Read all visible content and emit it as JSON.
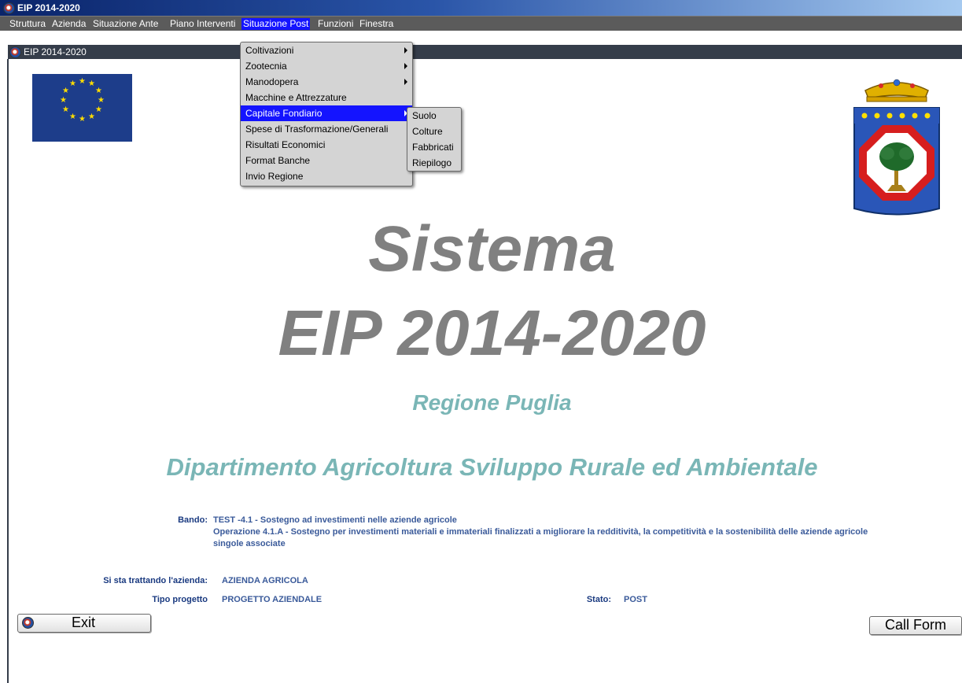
{
  "window": {
    "outer_title": "EIP 2014-2020",
    "inner_title": "EIP 2014-2020"
  },
  "menubar": [
    {
      "label": "Struttura"
    },
    {
      "label": "Azienda"
    },
    {
      "label": "Situazione Ante"
    },
    {
      "label": "Piano Interventi"
    },
    {
      "label": "Situazione Post"
    },
    {
      "label": "Funzioni"
    },
    {
      "label": "Finestra"
    }
  ],
  "dropdown_post": [
    {
      "label": "Coltivazioni"
    },
    {
      "label": "Zootecnia"
    },
    {
      "label": "Manodopera"
    },
    {
      "label": "Macchine e Attrezzature"
    },
    {
      "label": "Capitale Fondiario"
    },
    {
      "label": "Spese di Trasformazione/Generali"
    },
    {
      "label": "Risultati Economici"
    },
    {
      "label": "Format Banche"
    },
    {
      "label": "Invio Regione"
    }
  ],
  "submenu_capitale": [
    {
      "label": "Suolo"
    },
    {
      "label": "Colture"
    },
    {
      "label": "Fabbricati"
    },
    {
      "label": "Riepilogo"
    }
  ],
  "main": {
    "title1": "Sistema",
    "title2": "EIP 2014-2020",
    "region": "Regione Puglia",
    "department": "Dipartimento Agricoltura Sviluppo Rurale ed Ambientale"
  },
  "info": {
    "bando_label": "Bando:",
    "bando_line1": "TEST -4.1 - Sostegno ad investimenti nelle aziende agricole",
    "bando_line2": "Operazione 4.1.A - Sostegno per investimenti materiali e immateriali finalizzati a migliorare la redditività, la competitività e la sostenibilità delle aziende agricole",
    "bando_line3": "singole associate",
    "azienda_label": "Si sta trattando l'azienda:",
    "azienda_value": "AZIENDA AGRICOLA",
    "tipo_label": "Tipo progetto",
    "tipo_value": "PROGETTO AZIENDALE",
    "stato_label": "Stato:",
    "stato_value": "POST"
  },
  "buttons": {
    "exit": "Exit",
    "call_form": "Call Form"
  },
  "colors": {
    "menubar": "#5b5b5b",
    "highlight": "#1414ff",
    "title_grey": "#808080",
    "teal": "#7ab6b6"
  },
  "icons": {
    "app": "app-icon",
    "flag": "eu-flag",
    "coat": "puglia-coat-of-arms"
  }
}
